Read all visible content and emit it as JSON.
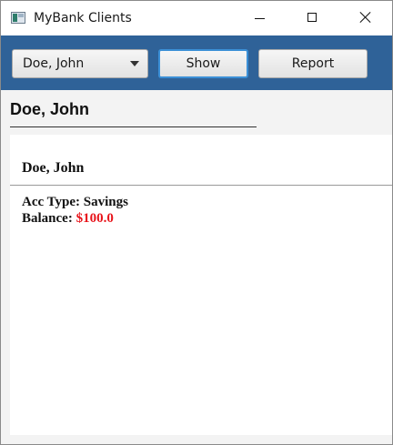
{
  "window": {
    "title": "MyBank Clients",
    "icon": "app-window-icon"
  },
  "toolbar": {
    "client_select": {
      "value": "Doe, John"
    },
    "show_label": "Show",
    "report_label": "Report"
  },
  "client": {
    "header_name": "Doe, John"
  },
  "details": {
    "name": "Doe, John",
    "acc_type_label": "Acc Type:",
    "acc_type_value": "Savings",
    "balance_label": "Balance:",
    "balance_value": "$100.0"
  },
  "colors": {
    "toolbar_bg": "#2f6298",
    "balance_value": "#e8141b",
    "focus_border": "#3b8fd6"
  }
}
